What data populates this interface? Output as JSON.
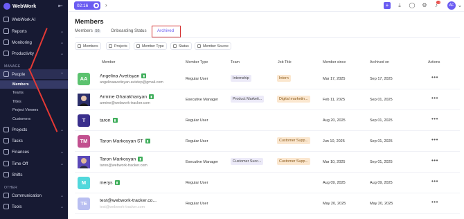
{
  "brand": {
    "name": "WebWork"
  },
  "sidebar": {
    "items": [
      {
        "label": "WebWork AI"
      },
      {
        "label": "Reports"
      },
      {
        "label": "Monitoring"
      },
      {
        "label": "Productivity"
      }
    ],
    "section_manage": "MANAGE",
    "people": {
      "label": "People"
    },
    "subitems": [
      {
        "label": "Members"
      },
      {
        "label": "Teams"
      },
      {
        "label": "Titles"
      },
      {
        "label": "Project Viewers"
      },
      {
        "label": "Customers"
      }
    ],
    "items2": [
      {
        "label": "Projects"
      },
      {
        "label": "Tasks"
      },
      {
        "label": "Finances"
      },
      {
        "label": "Time Off"
      },
      {
        "label": "Shifts"
      }
    ],
    "section_other": "OTHER",
    "items3": [
      {
        "label": "Communication"
      },
      {
        "label": "Tools"
      }
    ]
  },
  "topbar": {
    "timer": "02:16",
    "avatar": "AF",
    "notif_count": "12"
  },
  "page": {
    "title": "Members",
    "tabs": [
      {
        "label": "Members",
        "count": "56"
      },
      {
        "label": "Onboarding Status"
      },
      {
        "label": "Archived"
      }
    ],
    "filters": [
      "Members",
      "Projects",
      "Member Type",
      "Status",
      "Member Source"
    ]
  },
  "table": {
    "headers": [
      "Member",
      "Member Type",
      "Team",
      "Job Title",
      "Member since",
      "Archived on",
      "Actions"
    ],
    "rows": [
      {
        "initials": "AA",
        "color": "#5cc26f",
        "name": "Angelina Avetisyan",
        "email": "angelinaavetisyan.avistep@gmail.com",
        "type": "Regular User",
        "team": "Internship",
        "job": "Intern",
        "since": "Mar 17, 2025",
        "archived": "Sep 17, 2025"
      },
      {
        "initials": "",
        "color": "#3b3f8f",
        "name": "Armine Gharakhanyan",
        "email": "armine@webwork-tracker.com",
        "type": "Executive Manager",
        "team": "Product Marketi...",
        "job": "Digital marketin...",
        "since": "Feb 11, 2025",
        "archived": "Sep 01, 2025"
      },
      {
        "initials": "T",
        "color": "#3a2f8c",
        "name": "taron",
        "email": "",
        "type": "Regular User",
        "team": "",
        "job": "",
        "since": "Aug 20, 2025",
        "archived": "Sep 01, 2025"
      },
      {
        "initials": "TM",
        "color": "#c2508f",
        "name": "Taron Markosyan ST",
        "email": "",
        "type": "Regular User",
        "team": "",
        "job": "Customer Supp...",
        "since": "Jun 10, 2025",
        "archived": "Sep 01, 2025"
      },
      {
        "initials": "",
        "color": "#4a3aa3",
        "name": "Taron Markosyan",
        "email": "taron@webwork-tracker.com",
        "type": "Executive Manager",
        "team": "Customer Succ...",
        "job": "Customer Supp...",
        "since": "Mar 10, 2025",
        "archived": "Sep 01, 2025"
      },
      {
        "initials": "M",
        "color": "#52d8dc",
        "name": "merys",
        "email": "",
        "type": "Regular User",
        "team": "",
        "job": "",
        "since": "Aug 09, 2025",
        "archived": "Aug 09, 2025"
      },
      {
        "initials": "TE",
        "color": "#b9bff1",
        "name": "test@webwork-tracker.co...",
        "email": "test@webwork-tracker.com",
        "type": "Regular User",
        "team": "",
        "job": "",
        "since": "May 20, 2025",
        "archived": "May 20, 2025"
      }
    ]
  }
}
